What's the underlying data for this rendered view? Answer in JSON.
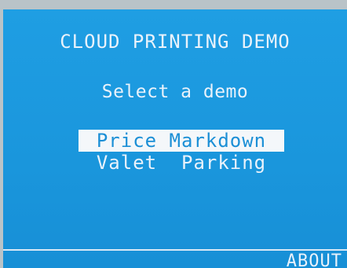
{
  "screen": {
    "title": "CLOUD PRINTING DEMO",
    "subtitle": "Select a demo",
    "menu": [
      {
        "label": "Price Markdown",
        "selected": true
      },
      {
        "label": "Valet  Parking",
        "selected": false
      }
    ],
    "softkey_right": "ABOUT"
  },
  "colors": {
    "screen_bg": "#1a96dc",
    "text": "#e9f2fb",
    "highlight_bg": "#f4f7fa",
    "highlight_text": "#1b8fd6"
  }
}
